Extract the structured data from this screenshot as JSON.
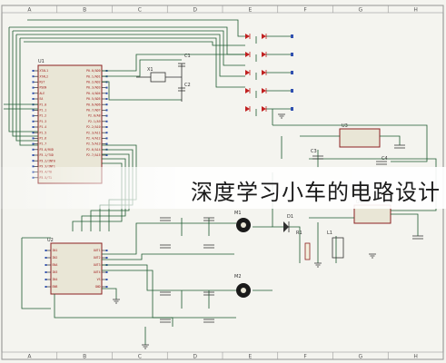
{
  "caption": "深度学习小车的电路设计",
  "grid_letters": [
    "A",
    "B",
    "C",
    "D",
    "E",
    "F",
    "G",
    "H"
  ],
  "u_main": {
    "ref": "U1",
    "left_pins": [
      "XTAL1",
      "XTAL2",
      "RST",
      "PSEN",
      "ALE",
      "EA",
      "P1.0",
      "P1.1",
      "P1.2",
      "P1.3",
      "P1.4",
      "P1.5",
      "P1.6",
      "P1.7",
      "P3.0/RXD",
      "P3.1/TXD",
      "P3.2/INT0",
      "P3.3/INT1",
      "P3.4/T0",
      "P3.5/T1"
    ],
    "right_pins": [
      "P0.0/AD0",
      "P0.1/AD1",
      "P0.2/AD2",
      "P0.3/AD3",
      "P0.4/AD4",
      "P0.5/AD5",
      "P0.6/AD6",
      "P0.7/AD7",
      "P2.0/A8",
      "P2.1/A9",
      "P2.2/A10",
      "P2.3/A11",
      "P2.4/A12",
      "P2.5/A13",
      "P2.6/A14",
      "P2.7/A15"
    ]
  },
  "u_driver": {
    "ref": "U2",
    "left_pins": [
      "IN1",
      "IN2",
      "ENA",
      "IN3",
      "IN4",
      "ENB"
    ],
    "right_pins": [
      "OUT1",
      "OUT2",
      "OUT3",
      "OUT4",
      "VS",
      "GND"
    ]
  },
  "crystal": {
    "ref": "X1"
  },
  "caps": [
    "C1",
    "C2",
    "C3",
    "C4"
  ],
  "regulators": [
    "U3",
    "U4"
  ],
  "motors": [
    "M1",
    "M2"
  ],
  "side_labels": [
    "R1",
    "D1",
    "L1"
  ]
}
